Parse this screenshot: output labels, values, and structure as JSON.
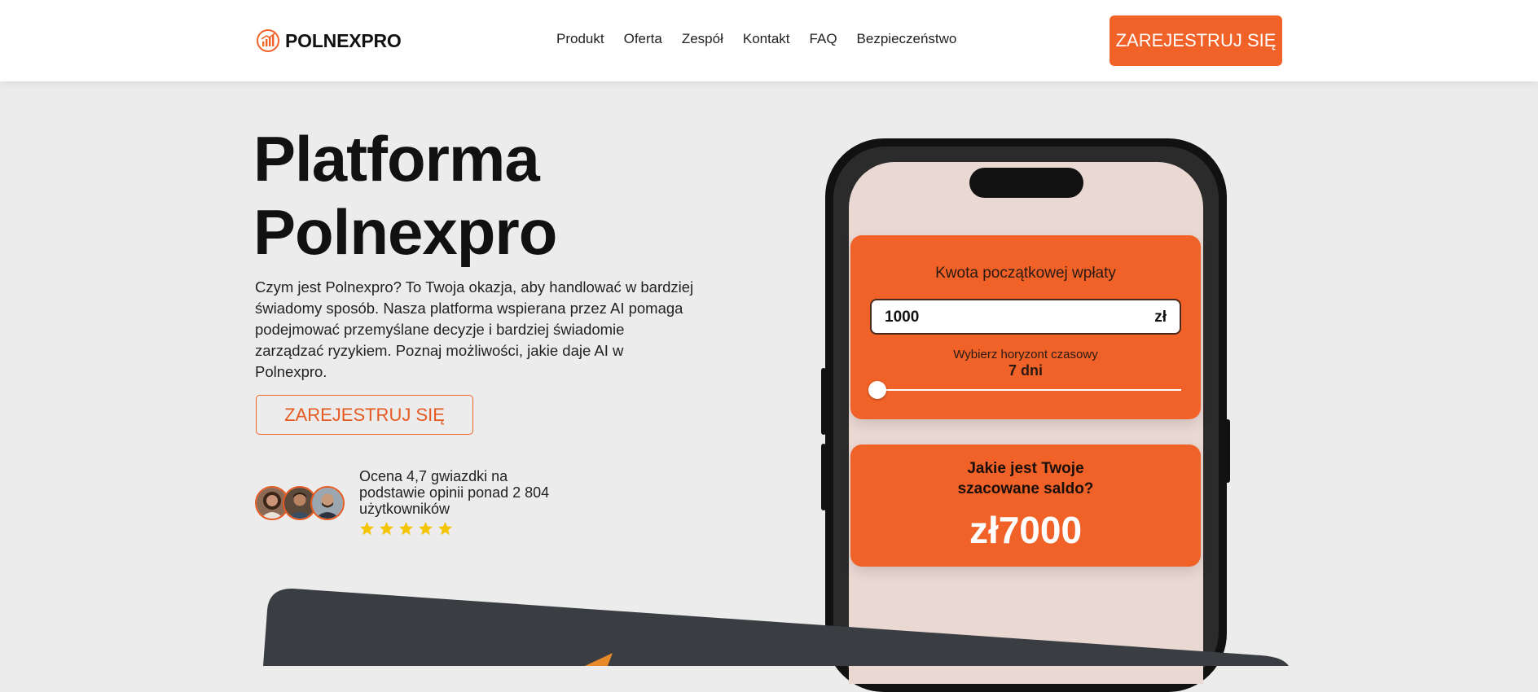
{
  "header": {
    "brand": "POLNEXPRO",
    "nav": [
      "Produkt",
      "Oferta",
      "Zespół",
      "Kontakt",
      "FAQ",
      "Bezpieczeństwo"
    ],
    "cta_label": "ZAREJESTRUJ SIĘ"
  },
  "hero": {
    "title_line1": "Platforma",
    "title_line2": "Polnexpro",
    "description": "Czym jest Polnexpro? To Twoja okazja, aby handlować w bardziej świadomy sposób. Nasza platforma wspierana przez AI pomaga podejmować przemyślane decyzje i bardziej świadomie zarządzać ryzykiem. Poznaj możliwości, jakie daje AI w Polnexpro.",
    "cta_label": "ZAREJESTRUJ SIĘ",
    "rating_text": "Ocena 4,7 gwiazdki na podstawie opinii ponad 2 804 użytkowników",
    "stars": 5
  },
  "calculator": {
    "amount_label": "Kwota początkowej wpłaty",
    "amount_value": "1000",
    "currency": "zł",
    "horizon_label": "Wybierz horyzont czasowy",
    "horizon_value": "7 dni",
    "slider_fraction": 0,
    "result_question_line1": "Jakie jest Twoje",
    "result_question_line2": "szacowane saldo?",
    "result_value": "zł7000"
  },
  "colors": {
    "accent": "#f06228",
    "background": "#ececec",
    "dark_panel": "#3a3d42",
    "star": "#f5c400"
  }
}
